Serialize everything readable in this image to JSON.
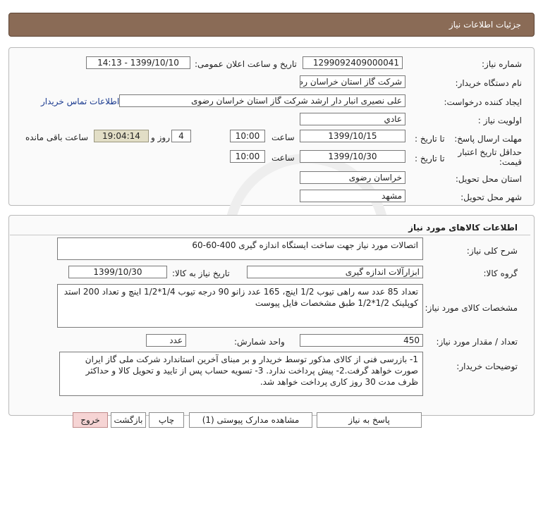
{
  "header": {
    "title": "جزئیات اطلاعات نیاز"
  },
  "need": {
    "number_label": "شماره نیاز:",
    "number": "1299092409000041",
    "announce_label": "تاریخ و ساعت اعلان عمومی:",
    "announce": "1399/10/10 - 14:13",
    "buyer_label": "نام دستگاه خریدار:",
    "buyer": "شرکت گاز استان خراسان رضوی",
    "creator_label": "ایجاد کننده درخواست:",
    "creator": "علی نصیری انبار دار  ارشد شرکت گاز استان خراسان رضوی",
    "contact_link": "اطلاعات تماس خریدار",
    "priority_label": "اولویت نیاز :",
    "priority": "عادي",
    "deadline_label": "مهلت ارسال پاسخ:",
    "to_date_label": "تا تاریخ :",
    "deadline_date": "1399/10/15",
    "time_label": "ساعت",
    "deadline_time": "10:00",
    "days_value": "4",
    "days_label": "روز و",
    "remaining_time": "19:04:14",
    "remaining_label": "ساعت باقی مانده",
    "validity_label_1": "حداقل تاریخ اعتبار",
    "validity_label_2": "قیمت:",
    "validity_to_label": "تا تاریخ :",
    "validity_date": "1399/10/30",
    "validity_time_label": "ساعت",
    "validity_time": "10:00",
    "province_label": "استان محل تحویل:",
    "province": "خراسان رضوی",
    "city_label": "شهر محل تحویل:",
    "city": "مشهد"
  },
  "goods": {
    "title": "اطلاعات کالاهای مورد نیاز",
    "general_desc_label": "شرح کلی نیاز:",
    "general_desc": "اتصالات مورد نیاز جهت ساخت  ایستگاه اندازه گیری 400-60-60",
    "group_label": "گروه کالا:",
    "group": "ابزارآلات اندازه گیری",
    "need_date_label": "تاریخ نیاز به کالا:",
    "need_date": "1399/10/30",
    "spec_label": "مشخصات کالای مورد نیاز:",
    "spec": "تعداد 85 عدد سه راهی تیوب 1/2 اینچ، 165 عدد زانو 90 درجه تیوب 1/4*1/2 اینچ و تعداد 200 استد کوپلینک 1/2*1/2 طبق مشخصات فایل پیوست",
    "qty_label": "تعداد / مقدار مورد نیاز:",
    "qty": "450",
    "unit_label": "واحد شمارش:",
    "unit": "عدد",
    "notes_label": "توضیحات خریدار:",
    "notes": "1- بازرسی فنی از کالای مذکور توسط خریدار و بر مبنای آخرین استاندارد شرکت ملی گاز ایران صورت خواهد گرفت.2- پیش پرداخت ندارد. 3- تسویه حساب پس از تایید و تحویل کالا و حداکثر ظرف مدت 30 روز کاری پرداخت خواهد شد."
  },
  "buttons": {
    "reply": "پاسخ به نیاز",
    "attachments": "مشاهده مدارک پیوستی (1)",
    "print": "چاپ",
    "back": "بازگشت",
    "exit": "خروج"
  },
  "colors": {
    "titlebar": "#8a6b56",
    "link": "#1a3a8f",
    "exit_button": "#f6d4d4"
  }
}
